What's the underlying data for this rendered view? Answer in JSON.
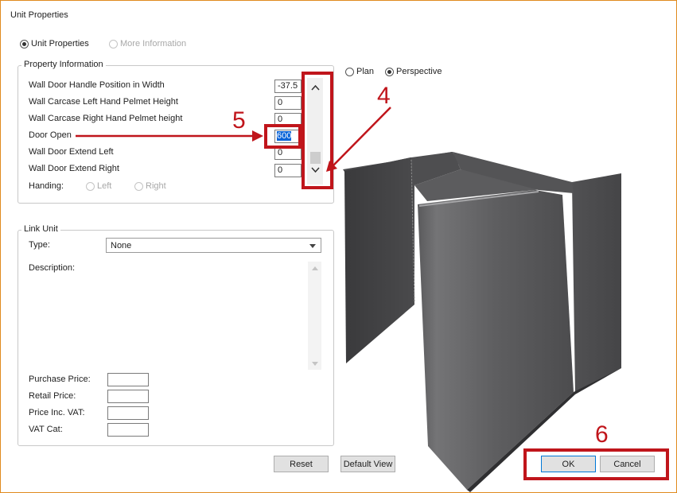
{
  "window": {
    "title": "Unit Properties"
  },
  "mode_tabs": [
    {
      "label": "Unit Properties",
      "selected": true,
      "enabled": true
    },
    {
      "label": "More Information",
      "selected": false,
      "enabled": false
    }
  ],
  "property_info": {
    "title": "Property Information",
    "rows": [
      {
        "label": "Wall Door Handle Position in Width",
        "value": "-37.5"
      },
      {
        "label": "Wall Carcase Left Hand Pelmet Height",
        "value": "0"
      },
      {
        "label": "Wall Carcase Right Hand Pelmet height",
        "value": "0"
      },
      {
        "label": "Door Open",
        "value": "600"
      },
      {
        "label": "Wall Door Extend Left",
        "value": "0"
      },
      {
        "label": "Wall Door Extend Right",
        "value": "0"
      }
    ],
    "handing": {
      "label": "Handing:",
      "options": [
        "Left",
        "Right"
      ]
    }
  },
  "view_options": [
    {
      "label": "Plan",
      "selected": false
    },
    {
      "label": "Perspective",
      "selected": true
    }
  ],
  "link_unit": {
    "title": "Link Unit",
    "type_label": "Type:",
    "type_value": "None",
    "description_label": "Description:",
    "price_fields": [
      "Purchase Price:",
      "Retail Price:",
      "Price Inc. VAT:",
      "VAT Cat:"
    ]
  },
  "buttons": {
    "reset": "Reset",
    "default_view": "Default View",
    "ok": "OK",
    "cancel": "Cancel"
  },
  "annotations": {
    "step4": "4",
    "step5": "5",
    "step6": "6"
  },
  "colors": {
    "annotation": "#c0151b",
    "selection": "#0a64d8",
    "window_border": "#e08a1e"
  }
}
